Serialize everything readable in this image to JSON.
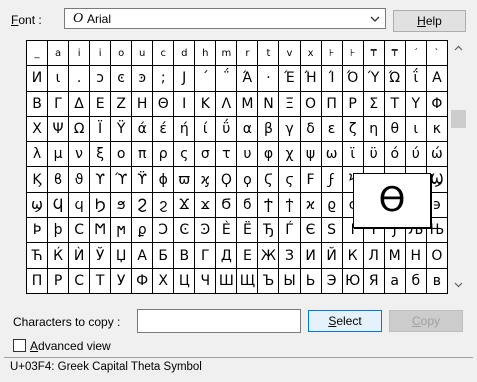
{
  "font": {
    "label_prefix": "F",
    "label_rest": "ont :",
    "icon": "opentype-font-icon",
    "selected": "Arial"
  },
  "help_button": {
    "accel": "H",
    "rest": "elp"
  },
  "grid_rows": [
    [
      "_",
      "a",
      "i",
      "i",
      "o",
      "u",
      "c",
      "d",
      "h",
      "m",
      "r",
      "t",
      "v",
      "x",
      "⊦",
      "⊦",
      "₸",
      "₸",
      "´",
      "`"
    ],
    [
      "И",
      "ι",
      ".",
      "ͻ",
      "ͼ",
      "ͽ",
      ";",
      "Ϳ",
      "΄",
      "΅",
      "Ά",
      "·",
      "Έ",
      "Ή",
      "Ί",
      "Ό",
      "Ύ",
      "Ώ",
      "ΐ",
      "Α"
    ],
    [
      "Β",
      "Γ",
      "Δ",
      "Ε",
      "Ζ",
      "Η",
      "Θ",
      "Ι",
      "Κ",
      "Λ",
      "Μ",
      "Ν",
      "Ξ",
      "Ο",
      "Π",
      "Ρ",
      "Σ",
      "Τ",
      "Υ",
      "Φ"
    ],
    [
      "Χ",
      "Ψ",
      "Ω",
      "Ϊ",
      "Ϋ",
      "ά",
      "έ",
      "ή",
      "ί",
      "ΰ",
      "α",
      "β",
      "γ",
      "δ",
      "ε",
      "ζ",
      "η",
      "θ",
      "ι",
      "κ"
    ],
    [
      "λ",
      "μ",
      "ν",
      "ξ",
      "ο",
      "π",
      "ρ",
      "ς",
      "σ",
      "τ",
      "υ",
      "φ",
      "χ",
      "ψ",
      "ω",
      "ϊ",
      "ϋ",
      "ό",
      "ύ",
      "ώ"
    ],
    [
      "Ϗ",
      "ϐ",
      "ϑ",
      "ϒ",
      "ϓ",
      "ϔ",
      "ϕ",
      "ϖ",
      "ϗ",
      "Ϙ",
      "ϙ",
      "Ϛ",
      "ϛ",
      "Ϝ",
      "ϝ",
      "Ϟ",
      "ϟ",
      "Ϡ",
      "ϡ",
      "Ϣ"
    ],
    [
      "ϣ",
      "Ϥ",
      "ϥ",
      "Ϧ",
      "ϧ",
      "Ϩ",
      "ϩ",
      "Ϫ",
      "ϫ",
      "Ϭ",
      "ϭ",
      "Ϯ",
      "ϯ",
      "ϰ",
      "ϱ",
      "ϲ",
      "ϳ",
      "ϴ",
      "ϵ",
      "϶"
    ],
    [
      "Ϸ",
      "ϸ",
      "Ϲ",
      "Ϻ",
      "ϻ",
      "ϼ",
      "Ͻ",
      "Ͼ",
      "Ͽ",
      "Ѐ",
      "Ё",
      "Ђ",
      "Ѓ",
      "Є",
      "Ѕ",
      "І",
      "Ї",
      "Ј",
      "Љ",
      "Њ"
    ],
    [
      "Ћ",
      "Ќ",
      "Ѝ",
      "Ў",
      "Џ",
      "А",
      "Б",
      "В",
      "Г",
      "Д",
      "Е",
      "Ж",
      "З",
      "И",
      "Й",
      "К",
      "Л",
      "М",
      "Н",
      "О"
    ],
    [
      "П",
      "Р",
      "С",
      "Т",
      "У",
      "Ф",
      "Х",
      "Ц",
      "Ч",
      "Ш",
      "Щ",
      "Ъ",
      "Ы",
      "Ь",
      "Э",
      "Ю",
      "Я",
      "а",
      "б",
      "в"
    ]
  ],
  "magnified_char": "ϴ",
  "copy_label": "Characters to copy :",
  "copy_value": "",
  "select_button": {
    "accel": "S",
    "rest": "elect"
  },
  "copy_button": {
    "accel": "C",
    "rest": "opy"
  },
  "advanced_view": {
    "accel": "A",
    "rest": "dvanced view",
    "checked": false
  },
  "status": "U+03F4: Greek Capital Theta Symbol"
}
